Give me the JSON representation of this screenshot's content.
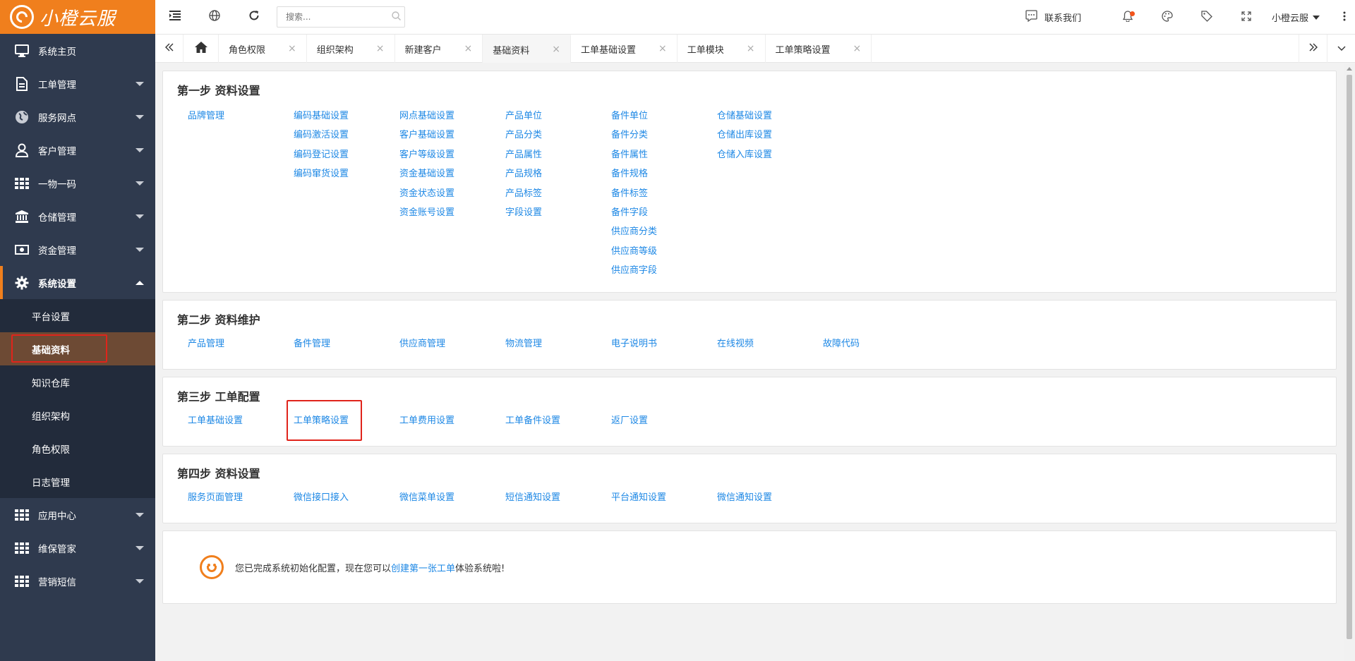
{
  "app": {
    "logo_text": "小橙云服",
    "brand_color": "#f07f1d"
  },
  "sidebar": {
    "items": [
      {
        "label": "系统主页",
        "icon": "monitor-icon",
        "expandable": false
      },
      {
        "label": "工单管理",
        "icon": "document-icon",
        "expandable": true
      },
      {
        "label": "服务网点",
        "icon": "globe-icon",
        "expandable": true
      },
      {
        "label": "客户管理",
        "icon": "user-icon",
        "expandable": true
      },
      {
        "label": "一物一码",
        "icon": "grid-icon",
        "expandable": true
      },
      {
        "label": "仓储管理",
        "icon": "bank-icon",
        "expandable": true
      },
      {
        "label": "资金管理",
        "icon": "money-icon",
        "expandable": true
      },
      {
        "label": "系统设置",
        "icon": "gear-icon",
        "expandable": true,
        "expanded": true
      }
    ],
    "sub_items": [
      {
        "label": "平台设置"
      },
      {
        "label": "基础资料",
        "selected": true
      },
      {
        "label": "知识仓库"
      },
      {
        "label": "组织架构"
      },
      {
        "label": "角色权限"
      },
      {
        "label": "日志管理"
      }
    ],
    "items_after": [
      {
        "label": "应用中心",
        "icon": "grid-icon"
      },
      {
        "label": "维保管家",
        "icon": "grid-icon"
      },
      {
        "label": "营销短信",
        "icon": "grid-icon"
      }
    ]
  },
  "topbar": {
    "search_placeholder": "搜索...",
    "contact_label": "联系我们",
    "user_name": "小橙云服"
  },
  "tabs": [
    {
      "label": "角色权限",
      "active": false
    },
    {
      "label": "组织架构",
      "active": false
    },
    {
      "label": "新建客户",
      "active": false
    },
    {
      "label": "基础资料",
      "active": true
    },
    {
      "label": "工单基础设置",
      "active": false
    },
    {
      "label": "工单模块",
      "active": false
    },
    {
      "label": "工单策略设置",
      "active": false
    }
  ],
  "step1": {
    "title": "第一步 资料设置",
    "columns": [
      [
        "品牌管理"
      ],
      [
        "编码基础设置",
        "编码激活设置",
        "编码登记设置",
        "编码窜货设置"
      ],
      [
        "网点基础设置",
        "客户基础设置",
        "客户等级设置",
        "资金基础设置",
        "资金状态设置",
        "资金账号设置"
      ],
      [
        "产品单位",
        "产品分类",
        "产品属性",
        "产品规格",
        "产品标签",
        "字段设置"
      ],
      [
        "备件单位",
        "备件分类",
        "备件属性",
        "备件规格",
        "备件标签",
        "备件字段",
        "供应商分类",
        "供应商等级",
        "供应商字段"
      ],
      [
        "仓储基础设置",
        "仓储出库设置",
        "仓储入库设置"
      ]
    ]
  },
  "step2": {
    "title": "第二步 资料维护",
    "links": [
      "产品管理",
      "备件管理",
      "供应商管理",
      "物流管理",
      "电子说明书",
      "在线视频",
      "故障代码"
    ]
  },
  "step3": {
    "title": "第三步 工单配置",
    "links": [
      "工单基础设置",
      "工单策略设置",
      "工单费用设置",
      "工单备件设置",
      "返厂设置"
    ]
  },
  "step4": {
    "title": "第四步 资料设置",
    "links": [
      "服务页面管理",
      "微信接口接入",
      "微信菜单设置",
      "短信通知设置",
      "平台通知设置",
      "微信通知设置"
    ]
  },
  "completion": {
    "prefix": "您已完成系统初始化配置，现在您可以",
    "link": "创建第一张工单",
    "suffix": "体验系统啦!"
  }
}
